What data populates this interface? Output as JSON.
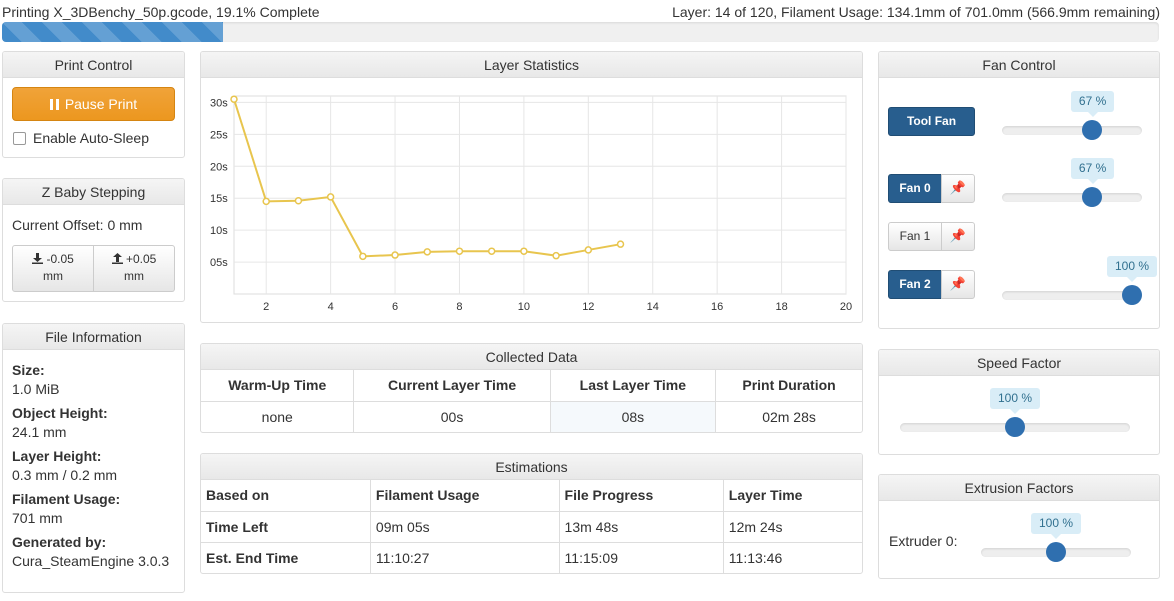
{
  "status": {
    "left": "Printing X_3DBenchy_50p.gcode, 19.1% Complete",
    "right": "Layer: 14 of 120, Filament Usage: 134.1mm of 701.0mm (566.9mm remaining)",
    "progress_percent": 19.1
  },
  "print_control": {
    "title": "Print Control",
    "pause_label": "Pause Print",
    "auto_sleep_label": "Enable Auto-Sleep"
  },
  "baby_stepping": {
    "title": "Z Baby Stepping",
    "offset_label": "Current Offset: 0 mm",
    "down_label": "-0.05",
    "down_unit": "mm",
    "up_label": "+0.05",
    "up_unit": "mm"
  },
  "file_info": {
    "title": "File Information",
    "items": [
      {
        "label": "Size:",
        "value": "1.0 MiB"
      },
      {
        "label": "Object Height:",
        "value": "24.1 mm"
      },
      {
        "label": "Layer Height:",
        "value": "0.3 mm / 0.2 mm"
      },
      {
        "label": "Filament Usage:",
        "value": "701 mm"
      },
      {
        "label": "Generated by:",
        "value": "Cura_SteamEngine 3.0.3"
      }
    ]
  },
  "layer_stats": {
    "title": "Layer Statistics"
  },
  "chart_data": {
    "type": "line",
    "title": "",
    "xlabel": "",
    "ylabel": "",
    "x": [
      1,
      2,
      3,
      4,
      5,
      6,
      7,
      8,
      9,
      10,
      11,
      12,
      13
    ],
    "series": [
      {
        "values": [
          30.5,
          14.5,
          14.6,
          15.2,
          5.9,
          6.1,
          6.6,
          6.7,
          6.7,
          6.7,
          6.0,
          6.9,
          7.8
        ]
      }
    ],
    "xlim": [
      1,
      20
    ],
    "ylim": [
      0,
      31
    ],
    "x_ticks": [
      2,
      4,
      6,
      8,
      10,
      12,
      14,
      16,
      18,
      20
    ],
    "y_ticks": [
      5,
      10,
      15,
      20,
      25,
      30
    ],
    "y_tick_labels": [
      "05s",
      "10s",
      "15s",
      "20s",
      "25s",
      "30s"
    ],
    "grid": true,
    "line_color": "#e8c54e"
  },
  "collected": {
    "title": "Collected Data",
    "headers": [
      "Warm-Up Time",
      "Current Layer Time",
      "Last Layer Time",
      "Print Duration"
    ],
    "values": [
      "none",
      "00s",
      "08s",
      "02m 28s"
    ]
  },
  "estimations": {
    "title": "Estimations",
    "headers": [
      "Based on",
      "Filament Usage",
      "File Progress",
      "Layer Time"
    ],
    "rows": [
      [
        "Time Left",
        "09m 05s",
        "13m 48s",
        "12m 24s"
      ],
      [
        "Est. End Time",
        "11:10:27",
        "11:15:09",
        "11:13:46"
      ]
    ]
  },
  "fan_control": {
    "title": "Fan Control",
    "tool_fan_label": "Tool Fan",
    "tool_fan_value": 67,
    "tool_fan_display": "67 %",
    "fans": [
      {
        "label": "Fan 0",
        "active": true,
        "value": 67,
        "display": "67 %",
        "has_slider": true
      },
      {
        "label": "Fan 1",
        "active": false,
        "has_slider": false
      },
      {
        "label": "Fan 2",
        "active": true,
        "value": 100,
        "display": "100 %",
        "has_slider": true
      }
    ]
  },
  "speed_factor": {
    "title": "Speed Factor",
    "value": 100,
    "display": "100 %"
  },
  "extrusion": {
    "title": "Extrusion Factors",
    "extruder_label": "Extruder 0:",
    "value": 100,
    "display": "100 %"
  }
}
